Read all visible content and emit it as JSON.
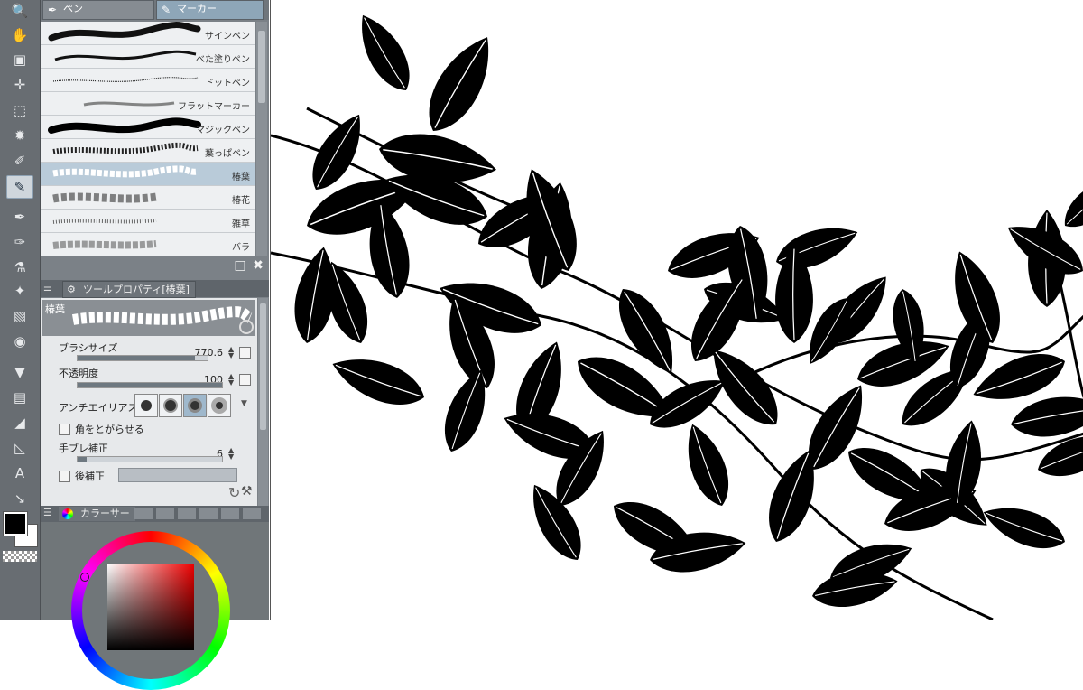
{
  "toolbar": {
    "tools": [
      "zoom-icon",
      "hand-icon",
      "object-icon",
      "operation-icon",
      "selection-icon",
      "auto-select-icon",
      "eyedropper-icon",
      "marker-icon",
      "pen-icon",
      "brush-icon",
      "airbrush-icon",
      "decoration-icon",
      "eraser-icon",
      "blend-icon",
      "fill-icon",
      "gradient-icon",
      "figure-icon",
      "ruler-icon",
      "text-icon",
      "balloon-icon"
    ],
    "active_tool": "marker-icon",
    "foreground_color": "#000000",
    "background_color": "#ffffff"
  },
  "subtool": {
    "tabs": [
      {
        "label": "ペン",
        "icon": "pen-icon"
      },
      {
        "label": "マーカー",
        "icon": "marker-icon"
      }
    ],
    "active_tab": "マーカー",
    "brushes": [
      {
        "name": "サインペン"
      },
      {
        "name": "べた塗りペン"
      },
      {
        "name": "ドットペン"
      },
      {
        "name": "フラットマーカー"
      },
      {
        "name": "マジックペン"
      },
      {
        "name": "葉っぱペン"
      },
      {
        "name": "椿葉"
      },
      {
        "name": "椿花"
      },
      {
        "name": "雑草"
      },
      {
        "name": "バラ"
      }
    ],
    "selected_brush": "椿葉"
  },
  "tool_property": {
    "title": "ツールプロパティ[椿葉]",
    "preview_label": "椿葉",
    "brush_size_label": "ブラシサイズ",
    "brush_size_value": "770.6",
    "brush_size_level": 0.9,
    "opacity_label": "不透明度",
    "opacity_value": "100",
    "opacity_level": 1.0,
    "antialias_label": "アンチエイリアス",
    "antialias_options": [
      "none",
      "weak",
      "medium",
      "strong"
    ],
    "antialias_selected": "medium",
    "sharp_corners_label": "角をとがらせる",
    "stabilization_label": "手ブレ補正",
    "stabilization_value": "6",
    "stabilization_level": 0.06,
    "post_correction_label": "後補正"
  },
  "color_panel": {
    "tab_label": "カラーサー",
    "accent": "#c93a3a"
  },
  "colors": {
    "toolbar_bg": "#686d72",
    "panel_bg": "#7b8187",
    "selected_row": "#b9cbd9",
    "leaf": "#000000",
    "canvas_bg": "#ffffff"
  }
}
